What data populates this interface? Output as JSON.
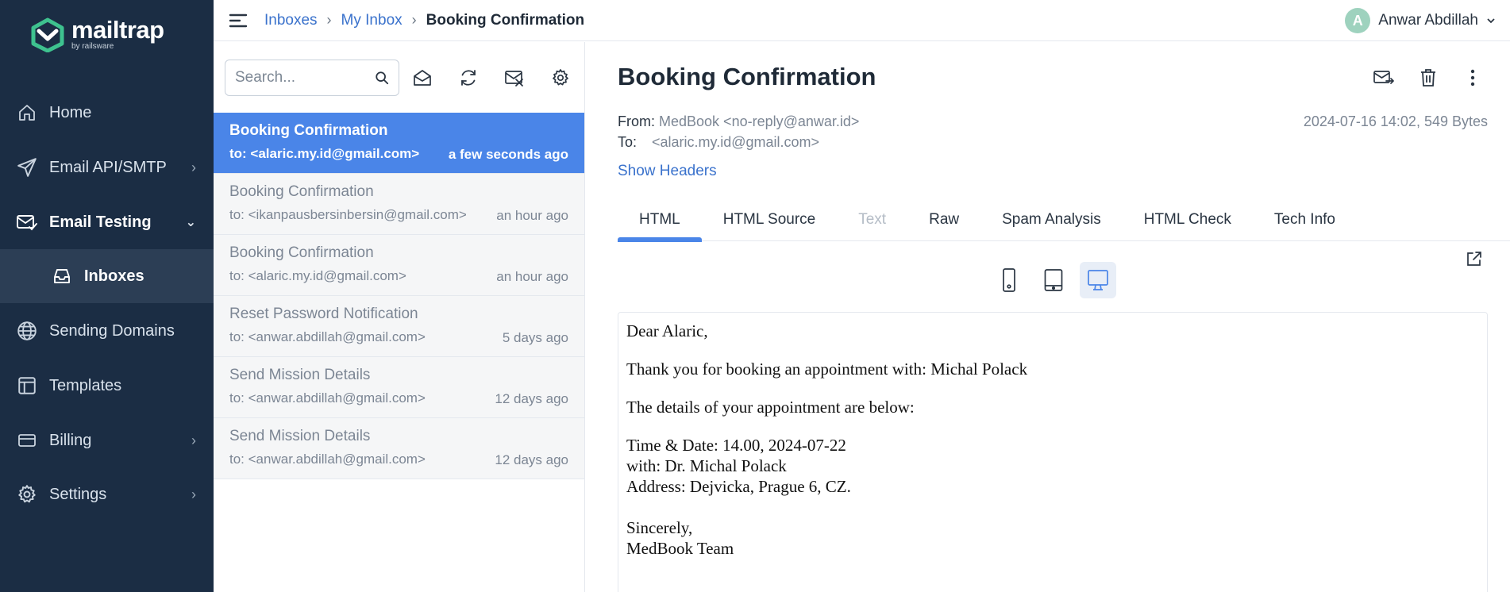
{
  "brand": {
    "name": "mailtrap",
    "sub": "by railsware"
  },
  "sidebar": {
    "items": [
      {
        "label": "Home",
        "icon": "home-icon"
      },
      {
        "label": "Email API/SMTP",
        "icon": "send-icon",
        "chevron": "›"
      },
      {
        "label": "Email Testing",
        "icon": "mail-check-icon",
        "chevron": "⌄",
        "active": true
      },
      {
        "label": "Inboxes",
        "icon": "inbox-icon",
        "sub": true
      },
      {
        "label": "Sending Domains",
        "icon": "globe-icon"
      },
      {
        "label": "Templates",
        "icon": "template-icon"
      },
      {
        "label": "Billing",
        "icon": "card-icon",
        "chevron": "›"
      },
      {
        "label": "Settings",
        "icon": "gear-icon",
        "chevron": "›"
      }
    ]
  },
  "breadcrumb": {
    "items": [
      "Inboxes",
      "My Inbox"
    ],
    "current": "Booking Confirmation",
    "separator": "›"
  },
  "user": {
    "initial": "A",
    "name": "Anwar Abdillah"
  },
  "search": {
    "placeholder": "Search..."
  },
  "messages": [
    {
      "subject": "Booking Confirmation",
      "to": "to: <alaric.my.id@gmail.com>",
      "time": "a few seconds ago"
    },
    {
      "subject": "Booking Confirmation",
      "to": "to: <ikanpausbersinbersin@gmail.com>",
      "time": "an hour ago"
    },
    {
      "subject": "Booking Confirmation",
      "to": "to: <alaric.my.id@gmail.com>",
      "time": "an hour ago"
    },
    {
      "subject": "Reset Password Notification",
      "to": "to: <anwar.abdillah@gmail.com>",
      "time": "5 days ago"
    },
    {
      "subject": "Send Mission Details",
      "to": "to: <anwar.abdillah@gmail.com>",
      "time": "12 days ago"
    },
    {
      "subject": "Send Mission Details",
      "to": "to: <anwar.abdillah@gmail.com>",
      "time": "12 days ago"
    }
  ],
  "view": {
    "title": "Booking Confirmation",
    "from_label": "From:",
    "from": "MedBook <no-reply@anwar.id>",
    "to_label": "To:",
    "to": "<alaric.my.id@gmail.com>",
    "date_size": "2024-07-16 14:02, 549 Bytes",
    "show_headers": "Show Headers",
    "tabs": [
      "HTML",
      "HTML Source",
      "Text",
      "Raw",
      "Spam Analysis",
      "HTML Check",
      "Tech Info"
    ]
  },
  "email_body": {
    "greeting": "Dear Alaric,",
    "line1": "Thank you for booking an appointment with: Michal Polack",
    "line2": "The details of your appointment are below:",
    "detail1": "Time & Date: 14.00, 2024-07-22",
    "detail2": "with: Dr. Michal Polack",
    "detail3": "Address: Dejvicka, Prague 6, CZ.",
    "closing": "Sincerely,",
    "signature": "MedBook Team"
  },
  "colors": {
    "sidebar": "#1b2d44",
    "accent": "#4a85e8",
    "link": "#3a72cc",
    "logo_green": "#3ec28f"
  }
}
